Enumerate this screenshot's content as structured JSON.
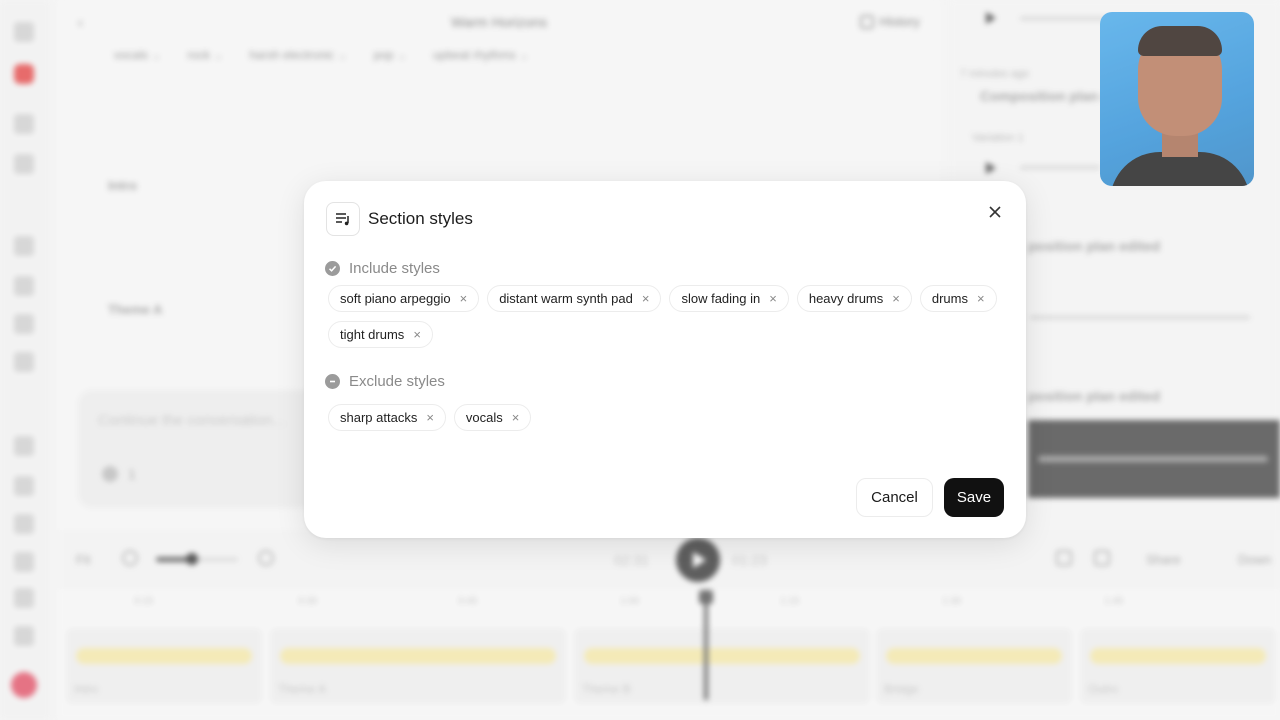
{
  "background": {
    "editor": {
      "title": "Warm Horizons",
      "history_label": "History",
      "style_tags": [
        "vocals",
        "rock",
        "harsh electronic",
        "pop",
        "upbeat rhythms"
      ],
      "section_intro": "Intro",
      "section_theme_a": "Theme A",
      "composer_placeholder": "Continue the conversation...",
      "composer_count": "1"
    },
    "right_panel": {
      "timestamp": "7 minutes ago",
      "item1": "Composition plan edited",
      "variation": "Variation 1",
      "item2": "position plan edited",
      "item3": "position plan edited"
    },
    "transport": {
      "fit_label": "Fit",
      "time_current": "02:31",
      "time_total": "01:23",
      "share_label": "Share",
      "download_label": "Down"
    },
    "timeline": {
      "ruler_ticks": [
        "0:15",
        "0:30",
        "0:45",
        "1:00",
        "1:15",
        "1:30",
        "1:45"
      ],
      "segments": [
        "Intro",
        "Theme A",
        "Theme B",
        "Bridge",
        "Outro"
      ]
    }
  },
  "modal": {
    "title": "Section styles",
    "include": {
      "label": "Include styles",
      "chips": [
        "soft piano arpeggio",
        "distant warm synth pad",
        "slow fading in",
        "heavy drums",
        "drums",
        "tight drums"
      ]
    },
    "exclude": {
      "label": "Exclude styles",
      "chips": [
        "sharp attacks",
        "vocals"
      ]
    },
    "cancel_label": "Cancel",
    "save_label": "Save",
    "chip_remove_glyph": "×"
  }
}
